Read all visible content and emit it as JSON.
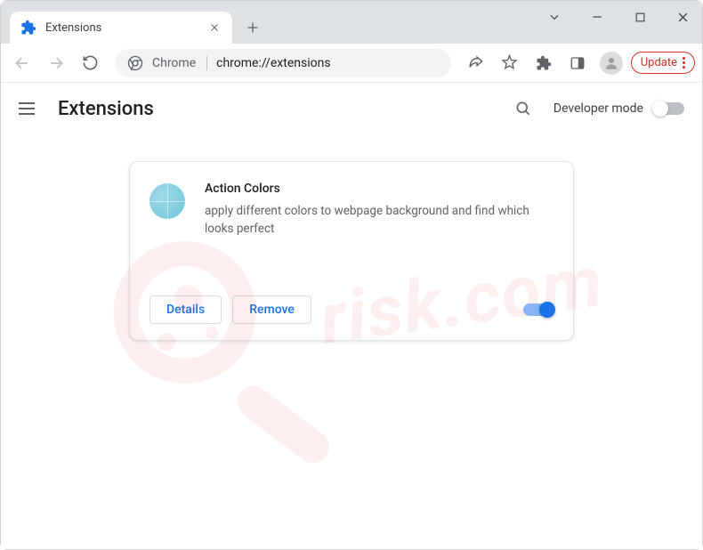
{
  "titlebar": {
    "tab_title": "Extensions"
  },
  "omnibox": {
    "chip_label": "Chrome",
    "url_prefix": "chrome://",
    "url_path": "extensions"
  },
  "toolbar": {
    "update_label": "Update"
  },
  "ext_header": {
    "title": "Extensions",
    "dev_mode_label": "Developer mode"
  },
  "card": {
    "name": "Action Colors",
    "description": "apply different colors to webpage background and find which looks perfect",
    "details_label": "Details",
    "remove_label": "Remove"
  },
  "watermark": {
    "text": "risk.com"
  }
}
